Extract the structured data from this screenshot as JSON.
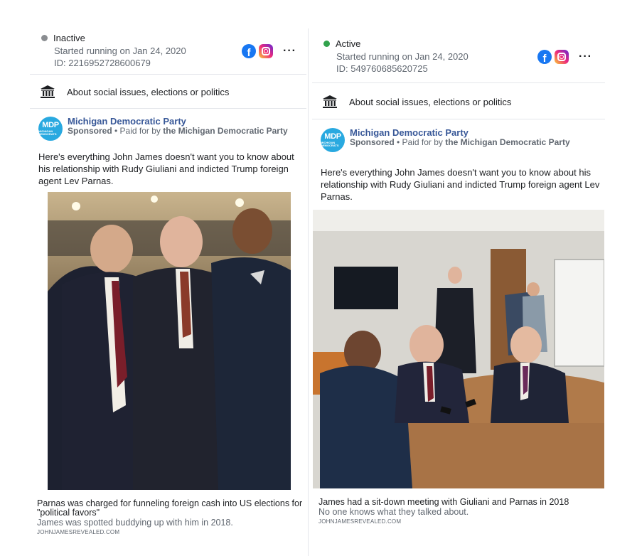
{
  "ads": [
    {
      "status": "Inactive",
      "status_color": "#8a8d91",
      "started": "Started running on Jan 24, 2020",
      "id": "ID: 2216952728600679",
      "platforms": [
        "facebook-icon",
        "instagram-icon"
      ],
      "more": "···",
      "category": "About social issues, elections or politics",
      "advertiser": {
        "avatar_big": "MDP",
        "avatar_small": "MICHIGAN DEMOCRATS",
        "name": "Michigan Democratic Party",
        "sponsored": "Sponsored",
        "paid_prefix": "• Paid for by",
        "paid_by": "the Michigan Democratic Party"
      },
      "body": "Here's everything John James doesn't want you to know about his relationship with Rudy Giuliani and indicted Trump foreign agent Lev Parnas.",
      "image": "Three men in suits standing together posing for a photo in an arena",
      "caption_title": "Parnas was charged for funneling foreign cash into US elections for \"political favors\"",
      "caption_desc": "James was spotted buddying up with him in 2018.",
      "link": "JOHNJAMESREVEALED.COM"
    },
    {
      "status": "Active",
      "status_color": "#31a24c",
      "started": "Started running on Jan 24, 2020",
      "id": "ID: 549760685620725",
      "platforms": [
        "facebook-icon",
        "instagram-icon"
      ],
      "more": "···",
      "category": "About social issues, elections or politics",
      "advertiser": {
        "avatar_big": "MDP",
        "avatar_small": "MICHIGAN DEMOCRATS",
        "name": "Michigan Democratic Party",
        "sponsored": "Sponsored",
        "paid_prefix": "• Paid for by",
        "paid_by": "the Michigan Democratic Party"
      },
      "body": "Here's everything John James doesn't want you to know about his relationship with Rudy Giuliani and indicted Trump foreign agent Lev Parnas.",
      "image": "Three men seated at a conference table in a meeting room",
      "caption_title": "James had a sit-down meeting with Giuliani and Parnas in 2018",
      "caption_desc": "No one knows what they talked about.",
      "link": "JOHNJAMESREVEALED.COM"
    }
  ]
}
